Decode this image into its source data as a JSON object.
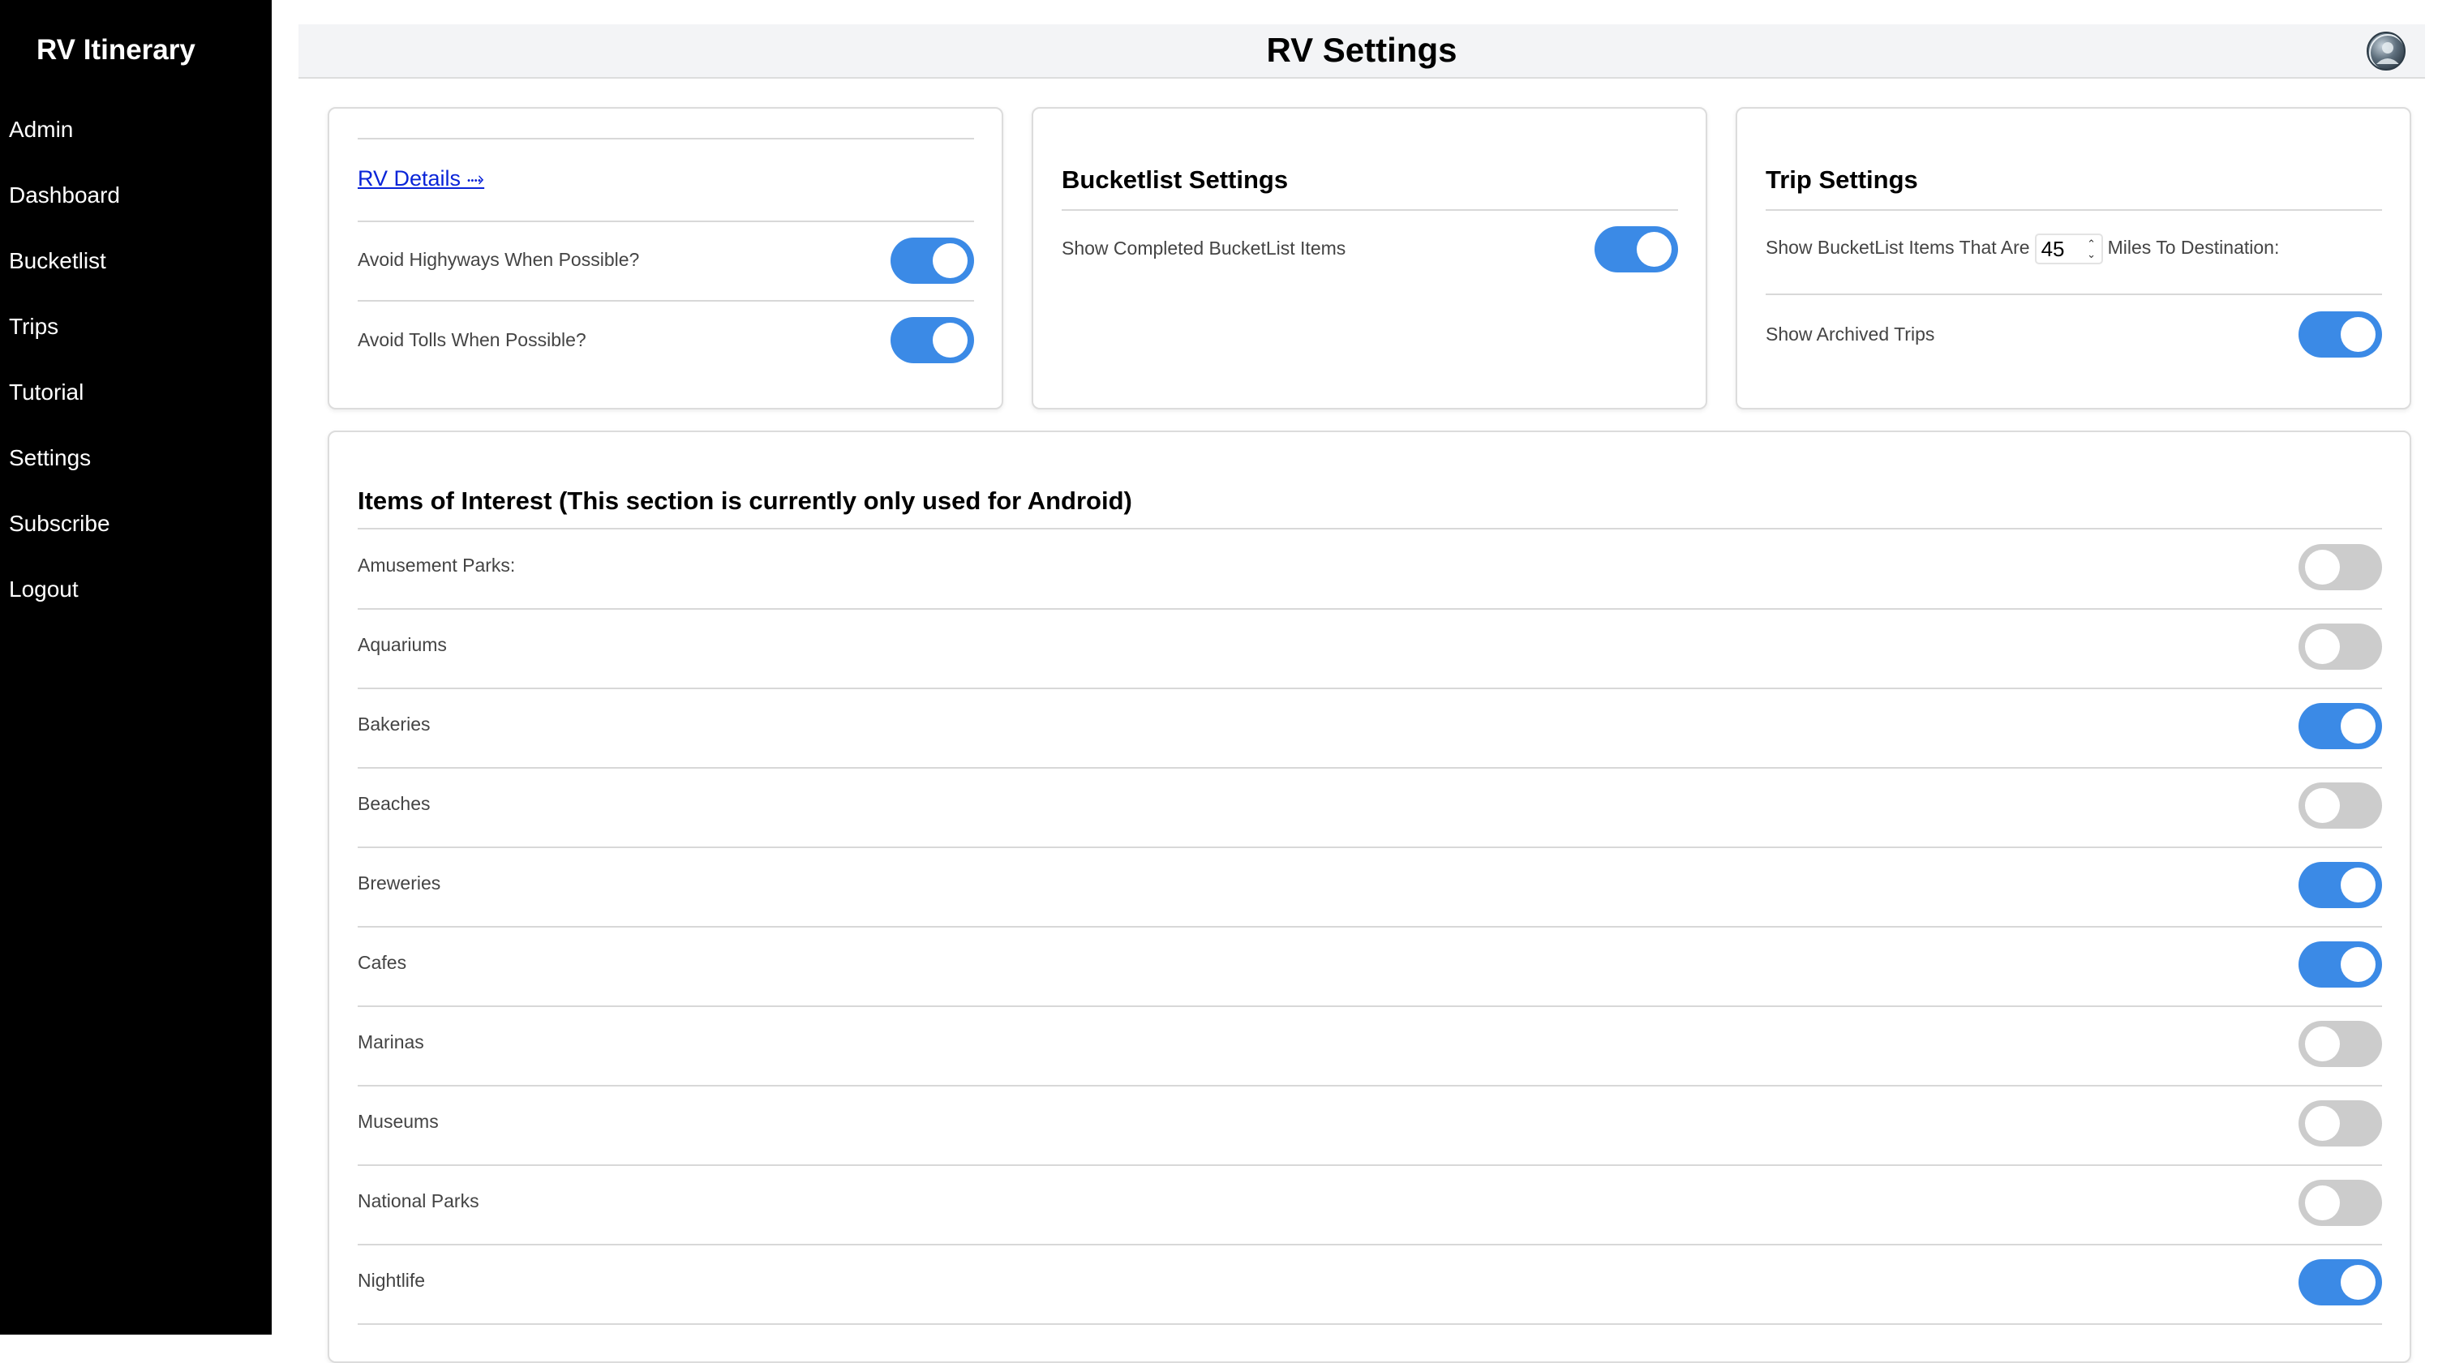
{
  "sidebar": {
    "brand": "RV Itinerary",
    "items": [
      {
        "label": "Admin"
      },
      {
        "label": "Dashboard"
      },
      {
        "label": "Bucketlist"
      },
      {
        "label": "Trips"
      },
      {
        "label": "Tutorial"
      },
      {
        "label": "Settings"
      },
      {
        "label": "Subscribe"
      },
      {
        "label": "Logout"
      }
    ]
  },
  "header": {
    "title": "RV Settings",
    "avatar_icon": "user-avatar-icon"
  },
  "rv_card": {
    "link_label": "RV Details ⤑",
    "rows": [
      {
        "label": "Avoid Highyways When Possible?",
        "on": true
      },
      {
        "label": "Avoid Tolls When Possible?",
        "on": true
      }
    ]
  },
  "bucketlist_card": {
    "title": "Bucketlist Settings",
    "rows": [
      {
        "label": "Show Completed BucketList Items",
        "on": true
      }
    ]
  },
  "trip_card": {
    "title": "Trip Settings",
    "distance_prefix": "Show BucketList Items That Are",
    "distance_value": "45",
    "distance_suffix": "Miles To Destination:",
    "stepper_icon": "up-down-stepper-icon",
    "rows": [
      {
        "label": "Show Archived Trips",
        "on": true
      }
    ]
  },
  "interest_card": {
    "title": "Items of Interest (This section is currently only used for Android)",
    "items": [
      {
        "label": "Amusement Parks:",
        "on": false
      },
      {
        "label": "Aquariums",
        "on": false
      },
      {
        "label": "Bakeries",
        "on": true
      },
      {
        "label": "Beaches",
        "on": false
      },
      {
        "label": "Breweries",
        "on": true
      },
      {
        "label": "Cafes",
        "on": true
      },
      {
        "label": "Marinas",
        "on": false
      },
      {
        "label": "Museums",
        "on": false
      },
      {
        "label": "National Parks",
        "on": false
      },
      {
        "label": "Nightlife",
        "on": true
      }
    ]
  },
  "colors": {
    "sidebar_bg": "#000000",
    "toggle_on": "#3b8ae6",
    "toggle_off": "#cccccc",
    "link": "#0a24d8",
    "header_bg": "#f3f4f6"
  }
}
